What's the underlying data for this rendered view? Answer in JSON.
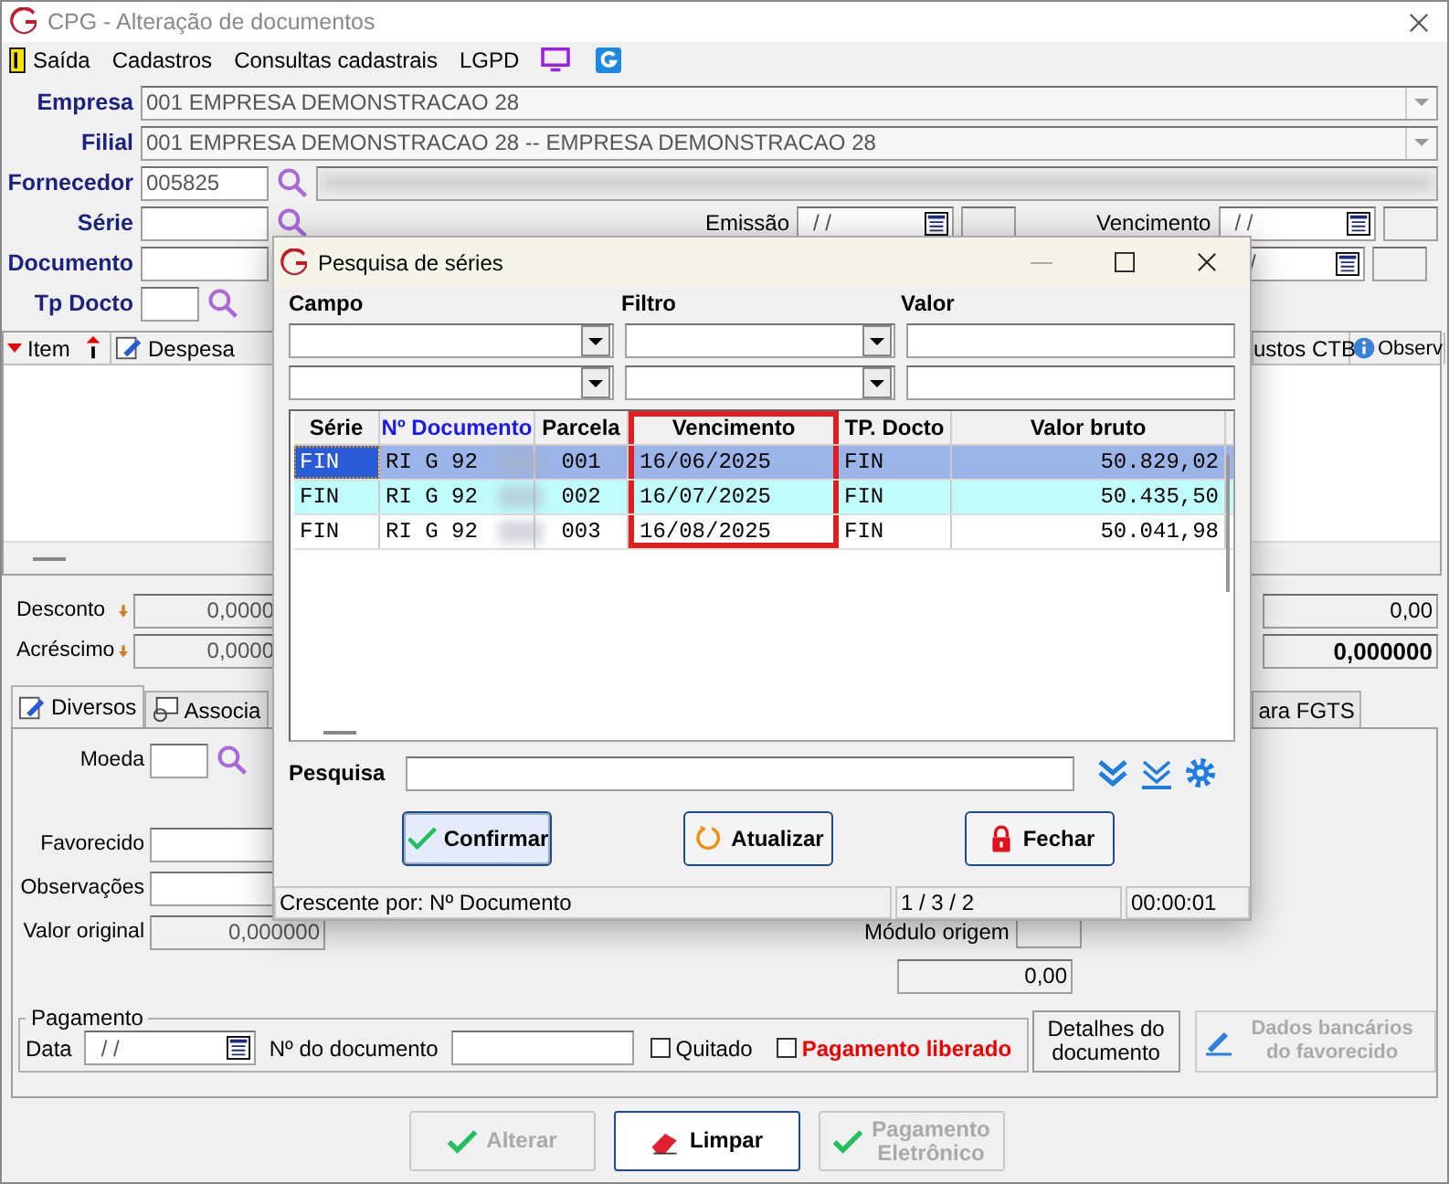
{
  "window": {
    "title": "CPG - Alteração de documentos"
  },
  "menu": [
    {
      "label": "Saída",
      "kind": "exit"
    },
    {
      "label": "Cadastros",
      "kind": "text"
    },
    {
      "label": "Consultas cadastrais",
      "kind": "text"
    },
    {
      "label": "LGPD",
      "kind": "text"
    }
  ],
  "header": {
    "empresa": {
      "label": "Empresa",
      "value": "001 EMPRESA DEMONSTRACAO 28"
    },
    "filial": {
      "label": "Filial",
      "value": "001 EMPRESA DEMONSTRACAO 28 -- EMPRESA DEMONSTRACAO 28"
    },
    "fornecedor": {
      "label": "Fornecedor",
      "value": "005825"
    },
    "serie": {
      "label": "Série"
    },
    "documento": {
      "label": "Documento"
    },
    "tp_docto": {
      "label": "Tp Docto"
    },
    "emissao": {
      "label": "Emissão",
      "value": "/ /"
    },
    "vencimento": {
      "label": "Vencimento",
      "value": "/ /"
    },
    "vencimento_2": {
      "value": "/"
    }
  },
  "items_grid": {
    "columns": [
      "Item",
      "Despesa",
      "ustos CTB",
      "Observ"
    ]
  },
  "totals": [
    {
      "label": "Desconto",
      "value": "0,0000",
      "right_value": "0,00",
      "bold": false
    },
    {
      "label": "Acréscimo",
      "value": "0,0000",
      "right_value": "0,000000",
      "bold": true
    }
  ],
  "tabs": [
    {
      "label": "Diversos",
      "selected": true
    },
    {
      "label": "Associa",
      "selected": false
    },
    {
      "label": "ara FGTS",
      "selected": false
    }
  ],
  "diversos": {
    "moeda": "Moeda",
    "favorecido": "Favorecido",
    "observacoes": "Observações",
    "valor_original": {
      "label": "Valor original",
      "value": "0,000000"
    },
    "modulo_origem": "Módulo origem",
    "total_value": "0,00"
  },
  "pagamento": {
    "legend": "Pagamento",
    "data_label": "Data",
    "data_value": "/ /",
    "doc_label": "Nº do documento",
    "quitado": {
      "label": "Quitado",
      "checked": false
    },
    "liberado": {
      "label": "Pagamento liberado",
      "checked": false
    }
  },
  "side_buttons": [
    {
      "label": "Detalhes do documento",
      "disabled": false,
      "kind": "plain"
    },
    {
      "label": "Dados bancários do favorecido",
      "disabled": true,
      "kind": "pen"
    }
  ],
  "bottom_buttons": [
    {
      "label": "Alterar",
      "disabled": true,
      "focused": false,
      "kind": "check"
    },
    {
      "label": "Limpar",
      "disabled": false,
      "focused": true,
      "kind": "eraser"
    },
    {
      "label": "Pagamento Eletrônico",
      "disabled": true,
      "focused": false,
      "kind": "check"
    }
  ],
  "dialog": {
    "title": "Pesquisa de séries",
    "filter_labels": [
      "Campo",
      "Filtro",
      "Valor"
    ],
    "columns": [
      {
        "label": "Série",
        "sorted": false,
        "highlighted": false
      },
      {
        "label": "Nº Documento",
        "sorted": true,
        "highlighted": false
      },
      {
        "label": "Parcela",
        "sorted": false,
        "highlighted": false
      },
      {
        "label": "Vencimento",
        "sorted": false,
        "highlighted": true
      },
      {
        "label": "TP. Docto",
        "sorted": false,
        "highlighted": false
      },
      {
        "label": "Valor bruto",
        "sorted": false,
        "highlighted": false
      }
    ],
    "rows": [
      {
        "cells": [
          "FIN",
          "RI G 92",
          "001",
          "16/06/2025",
          "FIN",
          "50.829,02"
        ],
        "selected": true,
        "hovered": false
      },
      {
        "cells": [
          "FIN",
          "RI G 92",
          "002",
          "16/07/2025",
          "FIN",
          "50.435,50"
        ],
        "selected": false,
        "hovered": true
      },
      {
        "cells": [
          "FIN",
          "RI G 92",
          "003",
          "16/08/2025",
          "FIN",
          "50.041,98"
        ],
        "selected": false,
        "hovered": false
      }
    ],
    "search_label": "Pesquisa",
    "buttons": [
      {
        "label": "Confirmar",
        "kind": "confirm",
        "focused": true
      },
      {
        "label": "Atualizar",
        "kind": "refresh",
        "focused": false
      },
      {
        "label": "Fechar",
        "kind": "lock",
        "focused": false
      }
    ],
    "status": [
      "Crescente por: Nº Documento",
      "1 / 3 / 2",
      "00:00:01"
    ]
  }
}
